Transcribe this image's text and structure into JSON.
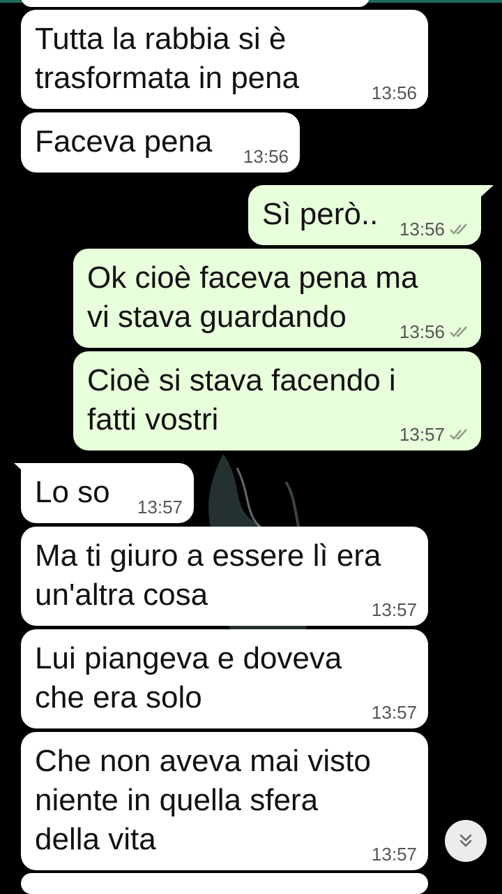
{
  "messages": [
    {
      "direction": "in",
      "text": "Tutta la rabbia si è\ntrasformata in pena",
      "time": "13:56"
    },
    {
      "direction": "in",
      "text": "Faceva pena",
      "time": "13:56"
    },
    {
      "direction": "out",
      "text": "Sì però..",
      "time": "13:56",
      "status": "read"
    },
    {
      "direction": "out",
      "text": "Ok cioè faceva pena ma\nvi stava guardando",
      "time": "13:56",
      "status": "read"
    },
    {
      "direction": "out",
      "text": "Cioè si stava facendo i\nfatti vostri",
      "time": "13:57",
      "status": "read"
    },
    {
      "direction": "in",
      "text": "Lo so",
      "time": "13:57"
    },
    {
      "direction": "in",
      "text": "Ma ti giuro a essere lì era\nun'altra cosa",
      "time": "13:57"
    },
    {
      "direction": "in",
      "text": "Lui piangeva e doveva\nche era solo",
      "time": "13:57"
    },
    {
      "direction": "in",
      "text": "Che non aveva mai visto\nniente in quella sfera\ndella vita",
      "time": "13:57"
    }
  ],
  "scroll_button": {
    "icon": "double-chevron-down-icon"
  },
  "colors": {
    "incoming": "#ffffff",
    "outgoing": "#e7ffdb",
    "background": "#000000",
    "read_ticks": "#8a9a8a"
  }
}
